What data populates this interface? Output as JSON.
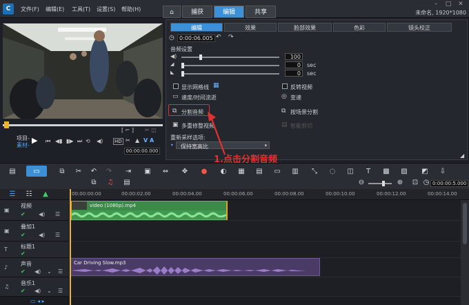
{
  "app": {
    "logo": "C",
    "project": "未命名, 1920*1080"
  },
  "menu": [
    "文件(F)",
    "编辑(E)",
    "工具(T)",
    "设置(S)",
    "帮助(H)"
  ],
  "window_tabs": {
    "home": "⌂",
    "capture": "捕获",
    "edit": "编辑",
    "share": "共享"
  },
  "preview": {
    "project_label": "项目-",
    "clip_label": "素材-",
    "timecode": "00:00:00.000",
    "hd_label": "HD"
  },
  "options_panel": {
    "tabs": [
      "编辑",
      "效果",
      "脸部效果",
      "色彩",
      "镜头校正"
    ],
    "timecode": "0:00:06.005",
    "audio_settings": "音频设置",
    "volume_value": "100",
    "fade_in_value": "0",
    "fade_out_value": "0",
    "sec_label": "sec",
    "show_grid": "显示网格线",
    "reverse_video": "反转视频",
    "speed_timelapse": "速度/时间流逝",
    "variable_speed": "变速",
    "split_audio": "分割音频",
    "split_by_scene": "按场景分割",
    "multi_trim": "多重修整视频",
    "smart_proxy": "智能剪切",
    "resample_label": "重新采样选项:",
    "resample_value": "保持宽高比"
  },
  "annotation": "1.点击分割音频",
  "timeline": {
    "zoom_timecode": "0:00:00:5.000",
    "ruler": [
      "00:00:00:00",
      "00:00:02.00",
      "00:00:04.00",
      "00:00:06.00",
      "00:00:08.00",
      "00:00:10.00",
      "00:00:12.00",
      "00:00:14.00"
    ],
    "tracks": [
      "视频",
      "叠加1",
      "标题1",
      "声音",
      "音乐1"
    ],
    "video_clip": "video (1080p).mp4",
    "audio_clip": "Car Driving Slow.mp3"
  }
}
